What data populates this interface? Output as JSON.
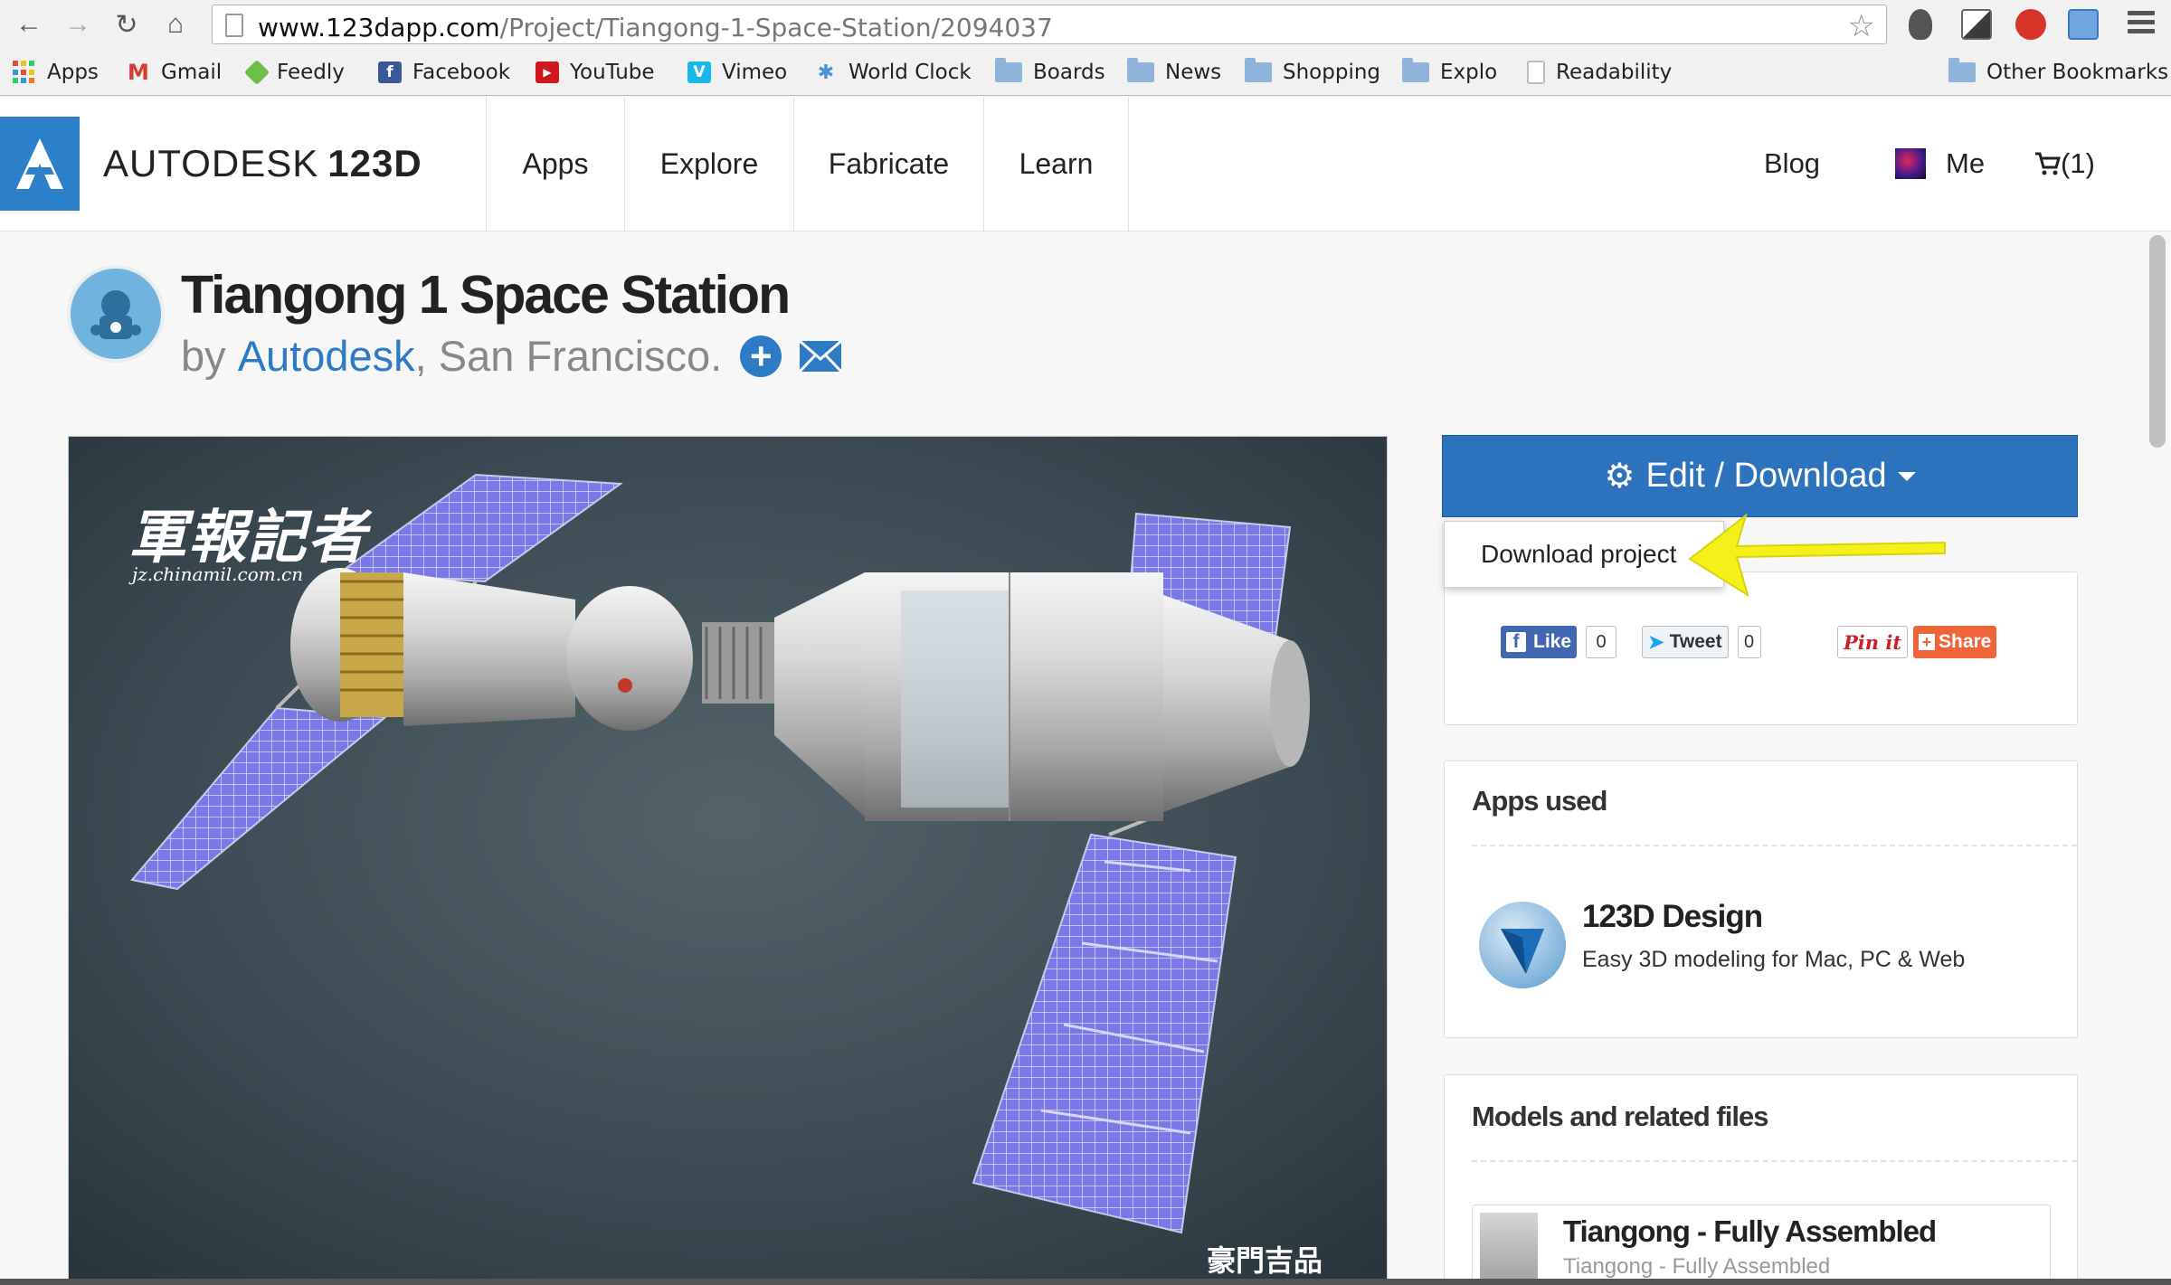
{
  "browser": {
    "url_host": "www.123dapp.com",
    "url_path": "/Project/Tiangong-1-Space-Station/2094037",
    "bookmarks": [
      {
        "label": "Apps",
        "icon": "apps-grid-icon"
      },
      {
        "label": "Gmail",
        "icon": "gmail-icon"
      },
      {
        "label": "Feedly",
        "icon": "feedly-icon"
      },
      {
        "label": "Facebook",
        "icon": "facebook-icon"
      },
      {
        "label": "YouTube",
        "icon": "youtube-icon"
      },
      {
        "label": "Vimeo",
        "icon": "vimeo-icon"
      },
      {
        "label": "World Clock",
        "icon": "world-clock-icon"
      },
      {
        "label": "Boards",
        "icon": "folder-icon"
      },
      {
        "label": "News",
        "icon": "folder-icon"
      },
      {
        "label": "Shopping",
        "icon": "folder-icon"
      },
      {
        "label": "Explo",
        "icon": "folder-icon"
      },
      {
        "label": "Readability",
        "icon": "page-icon"
      }
    ],
    "other_bookmarks": "Other Bookmarks"
  },
  "site": {
    "logo_brand": "AUTODESK",
    "logo_product": "123D",
    "nav": [
      "Apps",
      "Explore",
      "Fabricate",
      "Learn"
    ],
    "blog": "Blog",
    "me": "Me",
    "cart": "(1)"
  },
  "project": {
    "title": "Tiangong 1 Space Station",
    "by": "by",
    "author": "Autodesk",
    "location": ", San Francisco."
  },
  "hero": {
    "watermark_top": "軍報記者",
    "watermark_url": "jz.chinamil.com.cn",
    "watermark_bottom": "豪門吉品"
  },
  "sidebar": {
    "edit_download": "Edit / Download",
    "dropdown_item": "Download project",
    "social": {
      "like": "Like",
      "like_count": "0",
      "tweet": "Tweet",
      "tweet_count": "0",
      "pinit": "Pin it",
      "share": "Share"
    },
    "apps_used_header": "Apps used",
    "app_name": "123D Design",
    "app_desc": "Easy 3D modeling for Mac, PC & Web",
    "models_header": "Models and related files",
    "model_title": "Tiangong - Fully Assembled",
    "model_sub": "Tiangong - Fully Assembled"
  },
  "colors": {
    "accent_blue": "#2d72bd",
    "link_blue": "#2d7bc4",
    "arrow_yellow": "#f5f019",
    "solar_panel": "#7a78e6",
    "share_orange": "#f0643a"
  }
}
